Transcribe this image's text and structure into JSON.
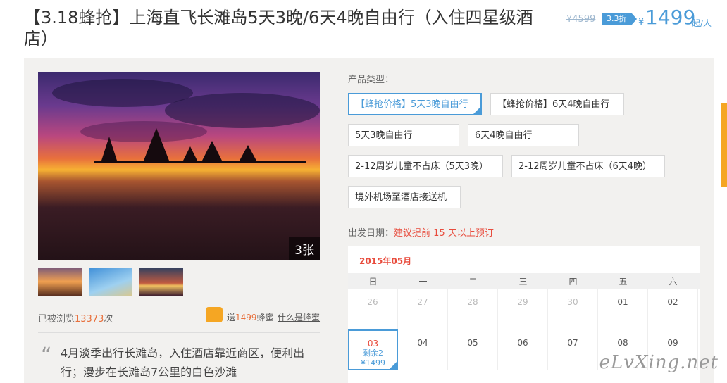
{
  "product": {
    "title": "【3.18蜂抢】上海直飞长滩岛5天3晚/6天4晚自由行（入住四星级酒店）",
    "old_price": "¥4599",
    "discount": "3.3折",
    "currency": "¥",
    "price": "1499",
    "unit": "起/人",
    "accent_color": "#4a9bd8",
    "highlight_color": "#e84c3d"
  },
  "gallery": {
    "photo_count": "3张",
    "thumbnails": [
      "thumb-1",
      "thumb-2",
      "thumb-3"
    ]
  },
  "stats": {
    "views_prefix": "已被浏览",
    "views_count": "13373",
    "views_suffix": "次",
    "gift_prefix": "送",
    "gift_count": "1499",
    "gift_suffix": "蜂蜜",
    "gift_link": "什么是蜂蜜"
  },
  "description": {
    "quote_mark": "“",
    "text": "4月淡季出行长滩岛，入住酒店靠近商区，便利出行；漫步在长滩岛7公里的白色沙滩"
  },
  "product_types": {
    "label": "产品类型：",
    "options": [
      {
        "label": "【蜂抢价格】5天3晚自由行",
        "selected": true
      },
      {
        "label": "【蜂抢价格】6天4晚自由行",
        "selected": false
      },
      {
        "label": "5天3晚自由行",
        "selected": false
      },
      {
        "label": "6天4晚自由行",
        "selected": false
      },
      {
        "label": "2-12周岁儿童不占床（5天3晚）",
        "selected": false
      },
      {
        "label": "2-12周岁儿童不占床（6天4晚）",
        "selected": false
      },
      {
        "label": "境外机场至酒店接送机",
        "selected": false
      }
    ]
  },
  "departure": {
    "label": "出发日期：",
    "hint": "建议提前 15 天以上预订"
  },
  "calendar": {
    "month": "2015年05月",
    "weekdays": [
      "日",
      "一",
      "二",
      "三",
      "四",
      "五",
      "六"
    ],
    "row1": [
      "26",
      "27",
      "28",
      "29",
      "30",
      "01",
      "02"
    ],
    "row2": [
      "03",
      "04",
      "05",
      "06",
      "07",
      "08",
      "09"
    ],
    "selected_day": {
      "remaining": "剩余2",
      "price": "¥1499"
    }
  },
  "watermark": "eLvXing.net"
}
